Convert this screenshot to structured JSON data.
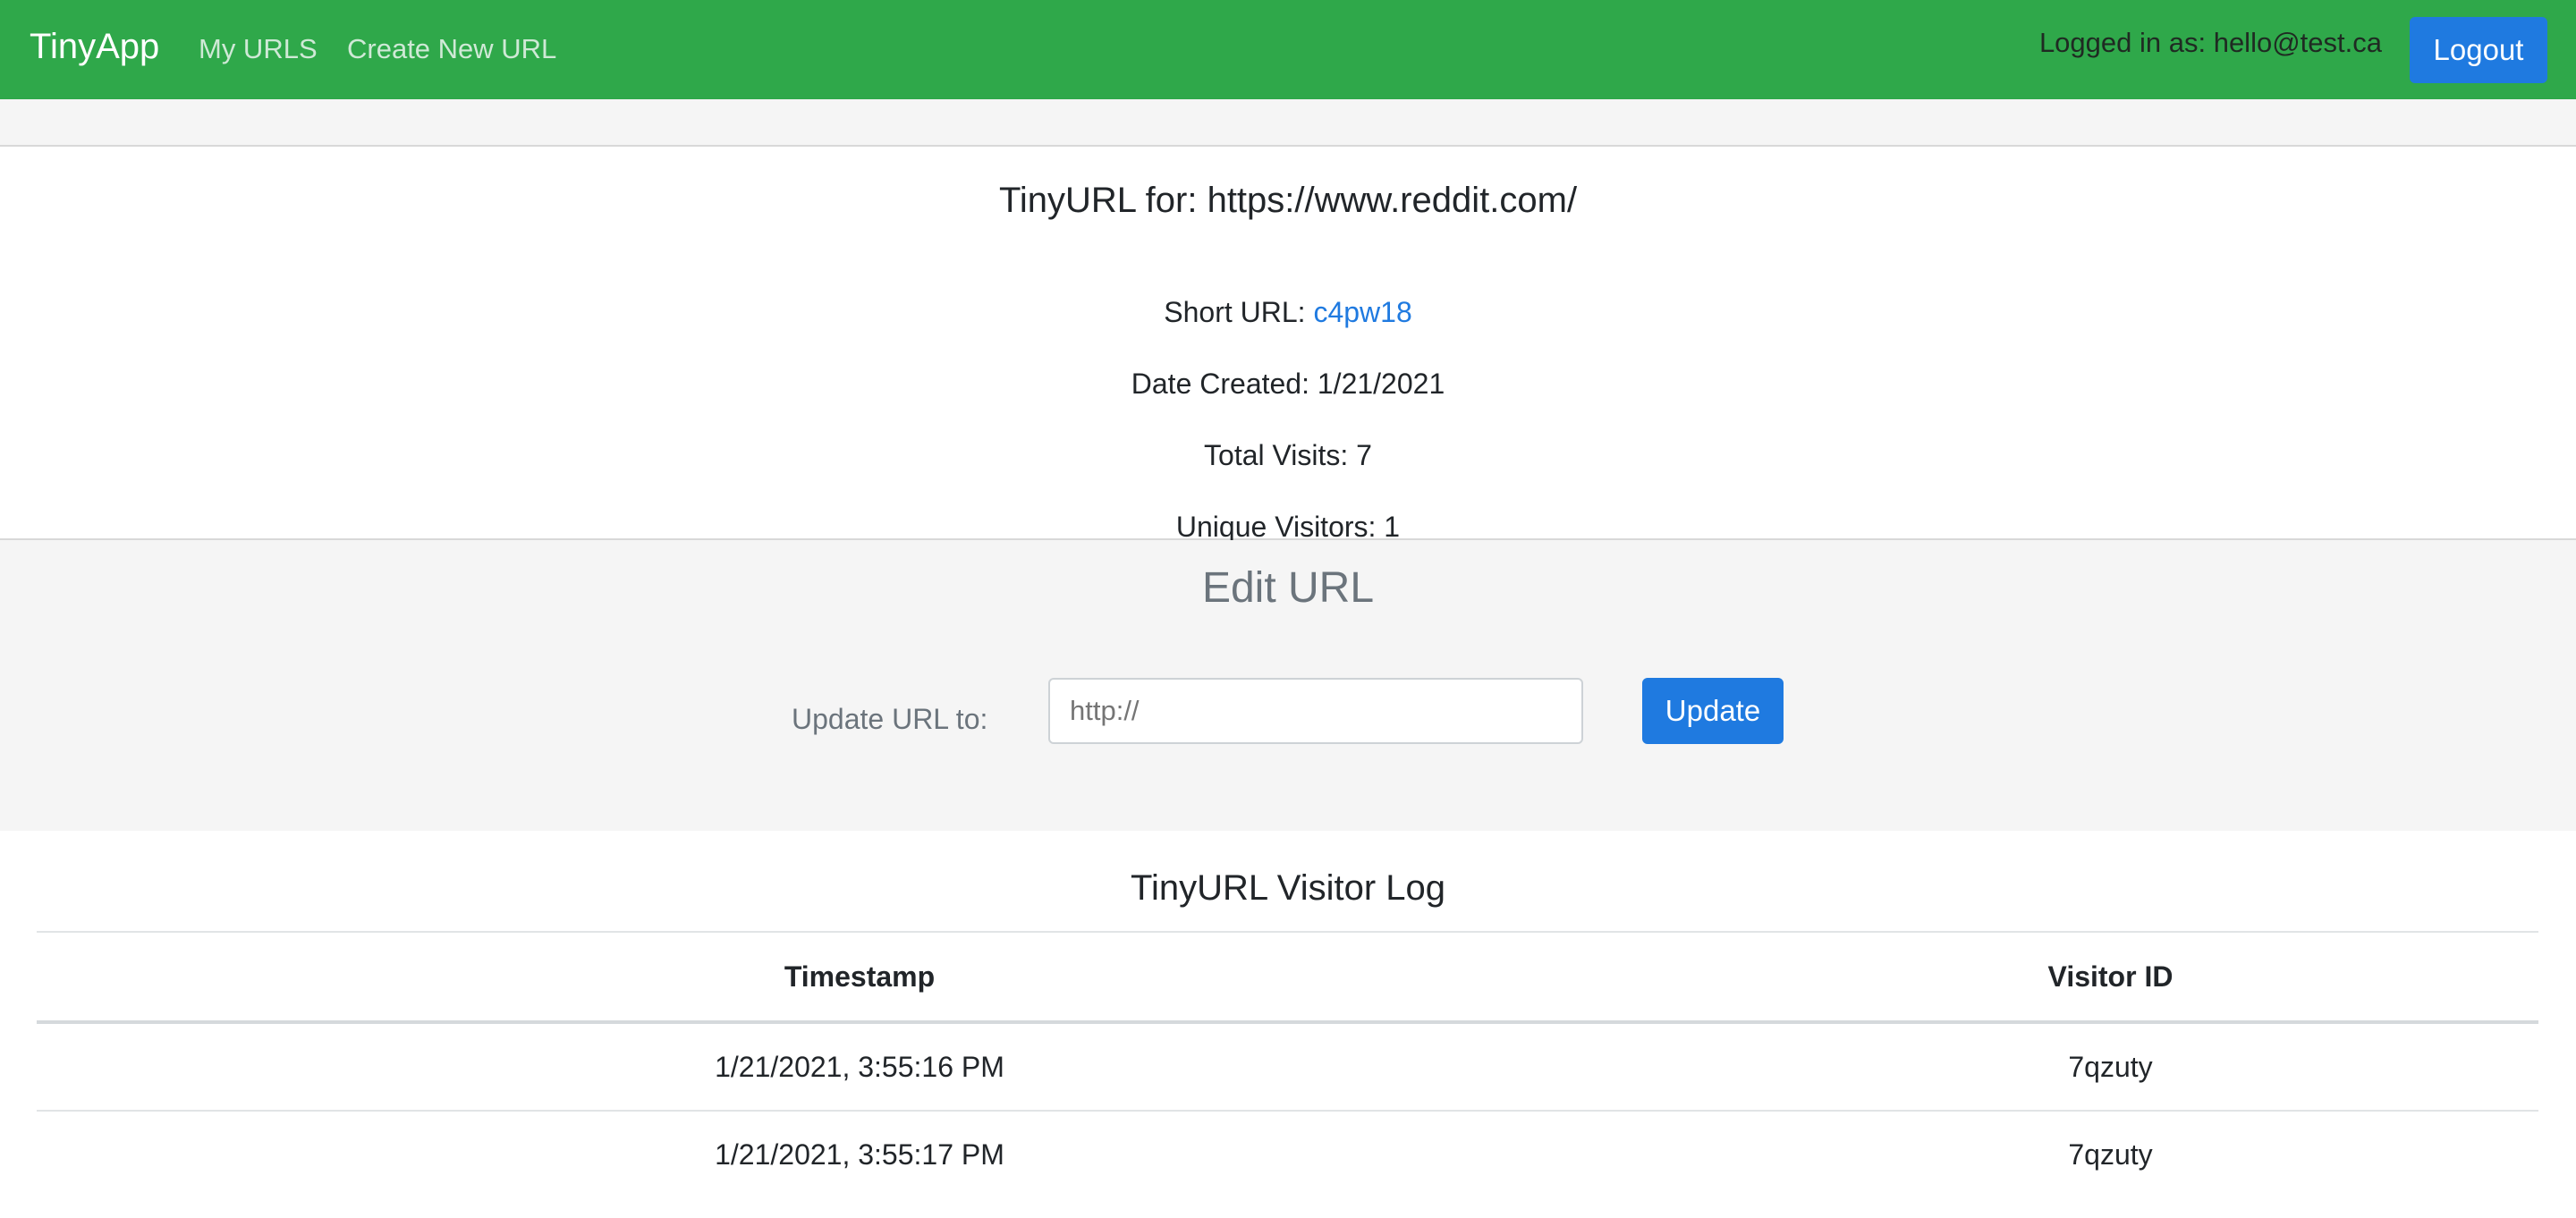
{
  "navbar": {
    "brand": "TinyApp",
    "links": [
      "My URLS",
      "Create New URL"
    ],
    "logged_in_text": "Logged in as: hello@test.ca",
    "logout_label": "Logout"
  },
  "url_info": {
    "title": "TinyURL for: https://www.reddit.com/",
    "short_url_label": "Short URL: ",
    "short_url": "c4pw18",
    "date_created": "Date Created: 1/21/2021",
    "total_visits": "Total Visits: 7",
    "unique_visitors": "Unique Visitors: 1"
  },
  "edit": {
    "title": "Edit URL",
    "label": "Update URL to:",
    "placeholder": "http://",
    "button_label": "Update"
  },
  "visitor_log": {
    "title": "TinyURL Visitor Log",
    "columns": [
      "Timestamp",
      "Visitor ID"
    ],
    "rows": [
      [
        "1/21/2021, 3:55:16 PM",
        "7qzuty"
      ],
      [
        "1/21/2021, 3:55:17 PM",
        "7qzuty"
      ]
    ]
  },
  "colors": {
    "navbar_bg": "#2fa84a",
    "primary_button": "#1f7ae0",
    "link": "#1f7ae0"
  }
}
